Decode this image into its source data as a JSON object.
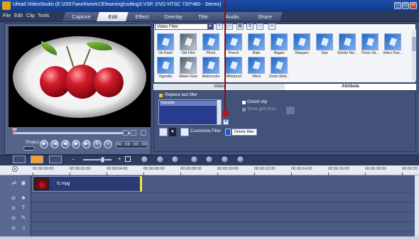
{
  "title_bar": {
    "title": "Ulead VideoStudio (E:\\2557\\work\\work1\\Elearning\\cutting3.VSP, DVD NTSC 720*480 - Stereo)"
  },
  "menu": {
    "items": [
      "File",
      "Edit",
      "Clip",
      "Tools"
    ]
  },
  "steps": [
    "Capture",
    "Edit",
    "Effect",
    "Overlay",
    "Title",
    "Audio",
    "Share"
  ],
  "active_step": "Edit",
  "preview": {
    "project_label": "Project",
    "clip_label": "Clip",
    "timecode": "00:00:00:00"
  },
  "library": {
    "category": "Video Filter",
    "filters_row1": [
      "Oil Paint",
      "Old Film",
      "Pinch",
      "Punch",
      "Rain",
      "Ripple",
      "Sharpen",
      "Star",
      "Strobe Mo...",
      "Three Sti...",
      "Video Pan..."
    ],
    "filters_row2": [
      "Vignette",
      "Water Flow",
      "Watercolor",
      "Whirlpool",
      "Wind",
      "Zoom Moti..."
    ]
  },
  "options": {
    "tabs": [
      "Video",
      "Attribute"
    ],
    "active_tab": "Attribute",
    "replace_last_filter": "Replace last filter",
    "applied_filters": [
      "Vignette"
    ],
    "distort_clip": "Distort clip",
    "show_grid_lines": "Show grid lines",
    "customize_filter": "Customize Filter",
    "delete_filter": "Delete filter"
  },
  "ruler": {
    "labels": [
      "00:00:00:00",
      "00:00:02:00",
      "00:00:04:00",
      "00:00:06:00",
      "00:00:08:00",
      "00:00:10:00",
      "00:00:12:00",
      "00:00:14:00",
      "00:00:16:00",
      "00:00:18:00",
      "00:00:20"
    ]
  },
  "timeline": {
    "clip_name": "f1.mpg"
  },
  "colors": {
    "accent": "#f0a028",
    "active_filter_row": "#6a7fbf",
    "playhead": "#ffe33a",
    "marker": "#b51528"
  }
}
